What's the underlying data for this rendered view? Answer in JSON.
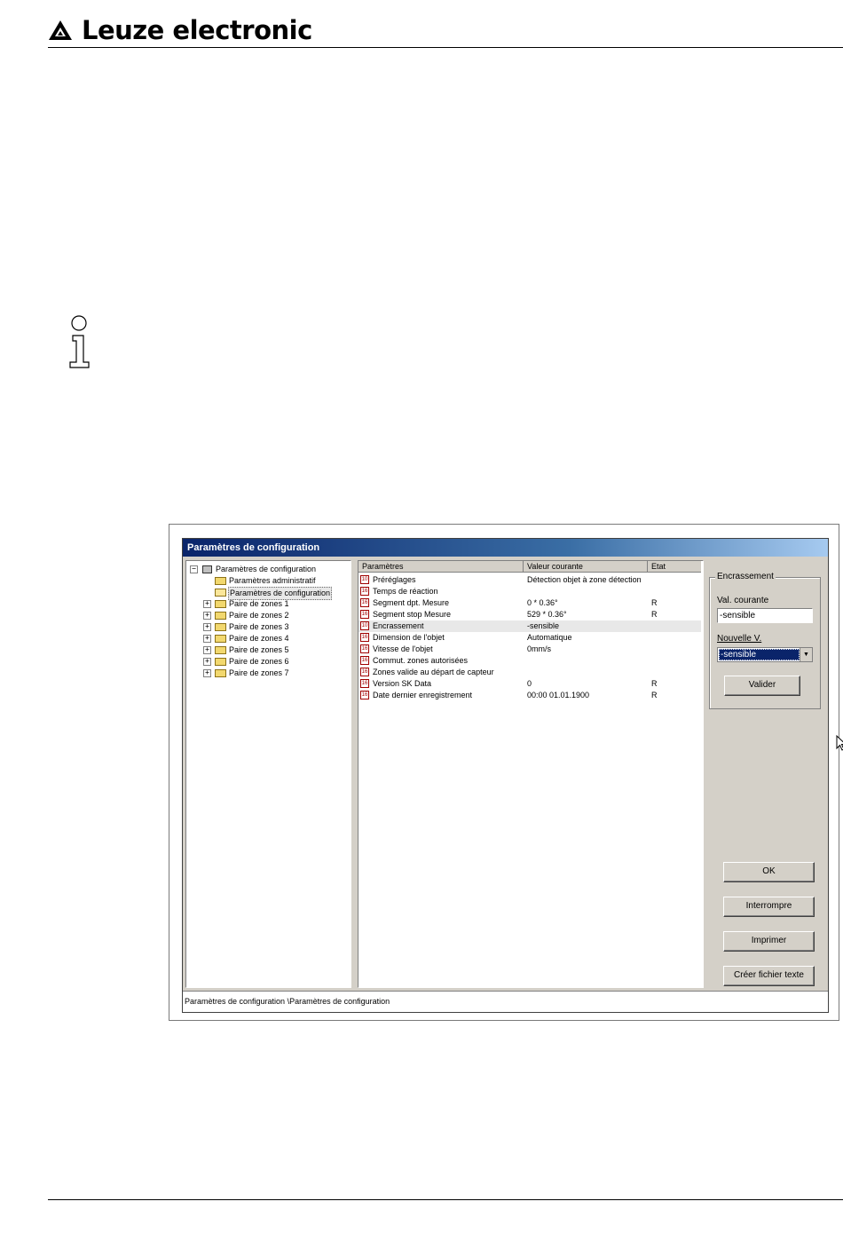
{
  "header": {
    "brand_name": "Leuze electronic"
  },
  "window": {
    "title": "Paramètres de configuration",
    "tree": {
      "root": "Paramètres de configuration",
      "items": [
        "Paramètres administratif",
        "Paramètres de configuration",
        "Paire de zones 1",
        "Paire de zones 2",
        "Paire de zones 3",
        "Paire de zones 4",
        "Paire de zones 5",
        "Paire de zones 6",
        "Paire de zones 7"
      ]
    },
    "grid": {
      "columns": [
        "Paramètres",
        "Valeur courante",
        "Etat"
      ],
      "rows": [
        {
          "param": "Préréglages",
          "value": "Détection objet à zone détection",
          "state": ""
        },
        {
          "param": "Temps de réaction",
          "value": "",
          "state": ""
        },
        {
          "param": "Segment dpt. Mesure",
          "value": "0 * 0.36°",
          "state": "R"
        },
        {
          "param": "Segment stop Mesure",
          "value": "529 * 0.36°",
          "state": "R"
        },
        {
          "param": "Encrassement",
          "value": "-sensible",
          "state": ""
        },
        {
          "param": "Dimension de l'objet",
          "value": "Automatique",
          "state": ""
        },
        {
          "param": "Vitesse de l'objet",
          "value": "0mm/s",
          "state": ""
        },
        {
          "param": "Commut. zones autorisées",
          "value": "",
          "state": ""
        },
        {
          "param": "Zones valide au départ de capteur",
          "value": "",
          "state": ""
        },
        {
          "param": "Version SK Data",
          "value": "0",
          "state": "R"
        },
        {
          "param": "Date dernier enregistrement",
          "value": "00:00 01.01.1900",
          "state": "R"
        }
      ]
    },
    "panel": {
      "group_title": "Encrassement",
      "current_label": "Val. courante",
      "current_value": "-sensible",
      "new_label": "Nouvelle V.",
      "new_value": "-sensible",
      "validate_button": "Valider",
      "ok_button": "OK",
      "abort_button": "Interrompre",
      "print_button": "Imprimer",
      "text_file_button": "Créer fichier texte"
    },
    "status_bar": "Paramètres de configuration \\Paramètres de configuration"
  },
  "colors": {
    "title_bar": "#0a246a",
    "selection": "#0a246a",
    "window_face": "#d4d0c8"
  }
}
